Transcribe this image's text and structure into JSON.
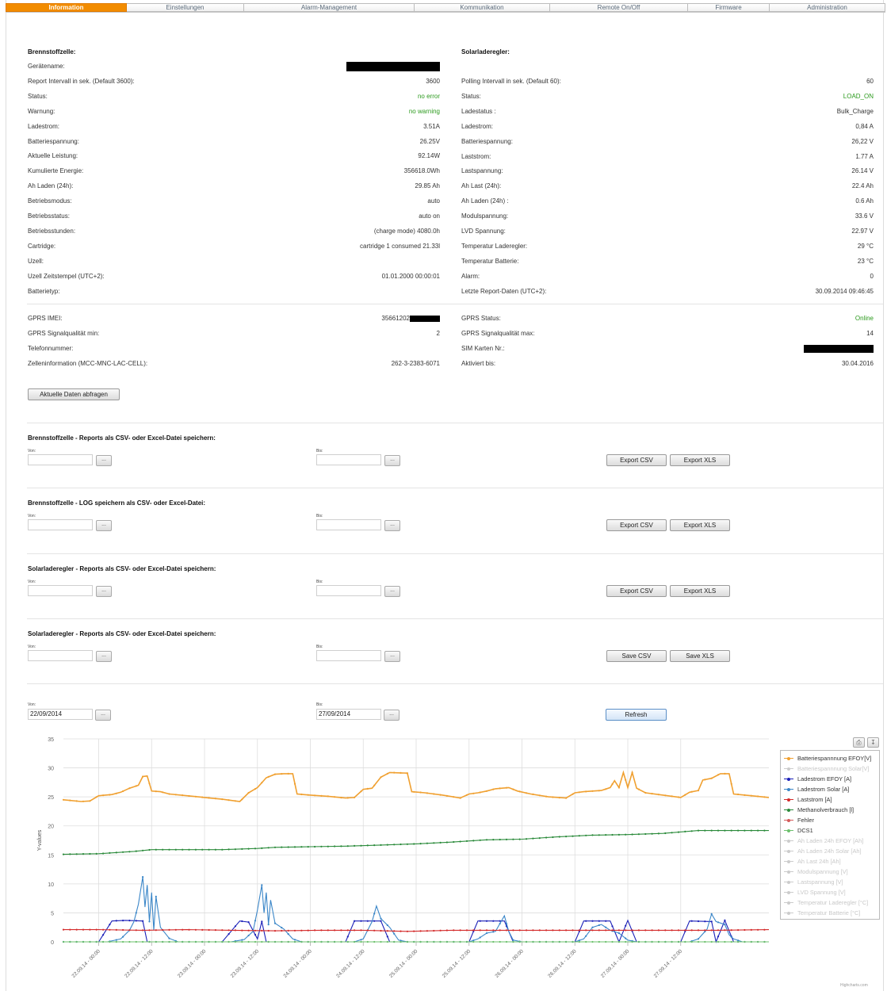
{
  "tabs": [
    "Information",
    "Einstellungen",
    "Alarm-Management",
    "Kommunikation",
    "Remote On/Off",
    "Firmware",
    "Administration"
  ],
  "fuelcell": {
    "title": "Brennstoffzelle:",
    "rows": [
      {
        "label": "Gerätename:",
        "value": ""
      },
      {
        "label": "Report Intervall in sek. (Default 3600):",
        "value": "3600"
      },
      {
        "label": "Status:",
        "value": "no error"
      },
      {
        "label": "Warnung:",
        "value": "no warning"
      },
      {
        "label": "Ladestrom:",
        "value": "3.51A"
      },
      {
        "label": "Batteriespannung:",
        "value": "26.25V"
      },
      {
        "label": "Aktuelle Leistung:",
        "value": "92.14W"
      },
      {
        "label": "Kumulierte Energie:",
        "value": "356618.0Wh"
      },
      {
        "label": "Ah Laden (24h):",
        "value": "29.85 Ah"
      },
      {
        "label": "Betriebsmodus:",
        "value": "auto"
      },
      {
        "label": "Betriebsstatus:",
        "value": "auto on"
      },
      {
        "label": "Betriebsstunden:",
        "value": "(charge mode) 4080.0h"
      },
      {
        "label": "Cartridge:",
        "value": "cartridge 1 consumed 21.33l"
      },
      {
        "label": "Uzell:",
        "value": ""
      },
      {
        "label": "Uzell Zeitstempel (UTC+2):",
        "value": "01.01.2000 00:00:01"
      },
      {
        "label": "Batterietyp:",
        "value": ""
      }
    ]
  },
  "solar": {
    "title": "Solarladeregler:",
    "rows": [
      {
        "label": "Polling Intervall in sek. (Default 60):",
        "value": "60"
      },
      {
        "label": "Status:",
        "value": "LOAD_ON"
      },
      {
        "label": "Ladestatus :",
        "value": "Bulk_Charge"
      },
      {
        "label": "Ladestrom:",
        "value": "0,84 A"
      },
      {
        "label": "Batteriespannung:",
        "value": "26,22 V"
      },
      {
        "label": "Laststrom:",
        "value": "1.77 A"
      },
      {
        "label": "Lastspannung:",
        "value": "26.14 V"
      },
      {
        "label": "Ah Last (24h):",
        "value": "22.4 Ah"
      },
      {
        "label": "Ah Laden (24h) :",
        "value": "0.6 Ah"
      },
      {
        "label": "Modulspannung:",
        "value": "33.6 V"
      },
      {
        "label": "LVD Spannung:",
        "value": "22.97 V"
      },
      {
        "label": "Temperatur Laderegler:",
        "value": "29 °C"
      },
      {
        "label": "Temperatur Batterie:",
        "value": "23 °C"
      },
      {
        "label": "Alarm:",
        "value": "0"
      },
      {
        "label": "Letzte Report-Daten (UTC+2):",
        "value": "30.09.2014 09:46:45"
      }
    ]
  },
  "gprs": {
    "left": [
      {
        "label": "GPRS IMEI:",
        "value": "35661202"
      },
      {
        "label": "GPRS Signalqualität min:",
        "value": "2"
      },
      {
        "label": "Telefonnummer:",
        "value": ""
      },
      {
        "label": "Zelleninformation (MCC-MNC-LAC-CELL):",
        "value": "262-3-2383-6071"
      }
    ],
    "right": [
      {
        "label": "GPRS Status:",
        "value": "Online"
      },
      {
        "label": "GPRS Signalqualität max:",
        "value": "14"
      },
      {
        "label": "SIM Karten Nr.:",
        "value": ""
      },
      {
        "label": "Aktiviert bis:",
        "value": "30.04.2016"
      }
    ]
  },
  "refresh_data_button": "Aktuelle Daten abfragen",
  "exports": [
    {
      "title": "Brennstoffzelle - Reports als CSV- oder Excel-Datei speichern:",
      "from_label": "Von:",
      "to_label": "Bis:",
      "btn1": "Export CSV",
      "btn2": "Export XLS"
    },
    {
      "title": "Brennstoffzelle - LOG speichern als CSV- oder Excel-Datei:",
      "from_label": "Von:",
      "to_label": "Bis:",
      "btn1": "Export CSV",
      "btn2": "Export XLS"
    },
    {
      "title": "Solarladeregler - Reports als CSV- oder Excel-Datei speichern:",
      "from_label": "Von:",
      "to_label": "Bis:",
      "btn1": "Export CSV",
      "btn2": "Export XLS"
    },
    {
      "title": "Solarladeregler - Reports als CSV- oder Excel-Datei speichern:",
      "from_label": "Von:",
      "to_label": "Bis:",
      "btn1": "Save CSV",
      "btn2": "Save XLS"
    }
  ],
  "picker_label": "...",
  "range": {
    "from_label": "Von:",
    "from_value": "22/09/2014",
    "to_label": "Bis:",
    "to_value": "27/09/2014",
    "refresh": "Refresh"
  },
  "chart_tools": {
    "print_icon": "printer-icon",
    "export_icon": "download-icon"
  },
  "credit": "Highcharts.com",
  "colors": {
    "accent_tab": "#f28c00",
    "ok_text": "#2c9a1e"
  },
  "chart_data": {
    "type": "line",
    "ylabel": "Y-values",
    "ylim": [
      0,
      35
    ],
    "yticks": [
      0,
      5,
      10,
      15,
      20,
      25,
      30,
      35
    ],
    "x_tick_labels": [
      "22.09.14 - 00:00",
      "22.09.14 - 12:00",
      "23.09.14 - 00:00",
      "23.09.14 - 12:00",
      "24.09.14 - 00:00",
      "24.09.14 - 12:00",
      "25.09.14 - 00:00",
      "25.09.14 - 12:00",
      "26.09.14 - 00:00",
      "26.09.14 - 12:00",
      "27.09.14 - 00:00",
      "27.09.14 - 12:00"
    ],
    "x_range_hours": [
      -8,
      152
    ],
    "legend_position": "right",
    "series": [
      {
        "name": "Batteriespannnung EFOY[V]",
        "color": "#f0a030",
        "visible": true,
        "points": [
          [
            -8,
            24.5
          ],
          [
            -4,
            24.2
          ],
          [
            -2,
            24.3
          ],
          [
            0,
            25.2
          ],
          [
            3,
            25.4
          ],
          [
            5,
            25.8
          ],
          [
            7,
            26.5
          ],
          [
            9,
            27.0
          ],
          [
            10,
            28.5
          ],
          [
            11,
            28.6
          ],
          [
            12,
            26.0
          ],
          [
            14,
            25.9
          ],
          [
            16,
            25.5
          ],
          [
            20,
            25.2
          ],
          [
            24,
            24.9
          ],
          [
            28,
            24.6
          ],
          [
            32,
            24.2
          ],
          [
            34,
            25.7
          ],
          [
            36,
            26.6
          ],
          [
            38,
            28.3
          ],
          [
            40,
            28.9
          ],
          [
            42,
            29.0
          ],
          [
            44,
            29.0
          ],
          [
            45,
            25.5
          ],
          [
            48,
            25.3
          ],
          [
            52,
            25.1
          ],
          [
            56,
            24.8
          ],
          [
            58,
            24.9
          ],
          [
            60,
            26.3
          ],
          [
            62,
            26.5
          ],
          [
            64,
            28.4
          ],
          [
            66,
            29.2
          ],
          [
            70,
            29.1
          ],
          [
            71,
            25.9
          ],
          [
            74,
            25.7
          ],
          [
            78,
            25.3
          ],
          [
            82,
            24.8
          ],
          [
            84,
            25.5
          ],
          [
            86,
            25.7
          ],
          [
            88,
            26.0
          ],
          [
            90,
            26.4
          ],
          [
            93,
            26.6
          ],
          [
            95,
            26.0
          ],
          [
            98,
            25.5
          ],
          [
            102,
            25.0
          ],
          [
            106,
            24.8
          ],
          [
            108,
            25.7
          ],
          [
            110,
            25.9
          ],
          [
            114,
            26.1
          ],
          [
            116,
            26.6
          ],
          [
            117,
            27.8
          ],
          [
            118,
            26.6
          ],
          [
            119,
            29.2
          ],
          [
            120,
            26.6
          ],
          [
            121,
            29.2
          ],
          [
            122,
            26.5
          ],
          [
            124,
            25.7
          ],
          [
            128,
            25.3
          ],
          [
            132,
            24.9
          ],
          [
            134,
            25.8
          ],
          [
            136,
            26.1
          ],
          [
            137,
            27.9
          ],
          [
            139,
            28.2
          ],
          [
            141,
            29.0
          ],
          [
            143,
            29.0
          ],
          [
            144,
            25.5
          ],
          [
            148,
            25.2
          ],
          [
            152,
            24.9
          ]
        ]
      },
      {
        "name": "Batteriespannnung Solar[V]",
        "color": "#cccccc",
        "visible": false,
        "points": []
      },
      {
        "name": "Ladestrom EFOY [A]",
        "color": "#1a1fb8",
        "visible": true,
        "points": [
          [
            -8,
            0
          ],
          [
            0,
            0
          ],
          [
            3,
            3.6
          ],
          [
            6,
            3.7
          ],
          [
            10,
            3.6
          ],
          [
            11,
            0
          ],
          [
            28,
            0
          ],
          [
            32,
            3.6
          ],
          [
            34,
            3.4
          ],
          [
            36,
            0.5
          ],
          [
            37,
            3.5
          ],
          [
            38,
            0
          ],
          [
            56,
            0
          ],
          [
            58,
            3.6
          ],
          [
            64,
            3.6
          ],
          [
            66,
            0
          ],
          [
            84,
            0
          ],
          [
            86,
            3.6
          ],
          [
            92,
            3.6
          ],
          [
            94,
            0
          ],
          [
            108,
            0
          ],
          [
            110,
            3.6
          ],
          [
            116,
            3.6
          ],
          [
            118,
            0
          ],
          [
            120,
            3.7
          ],
          [
            122,
            0
          ],
          [
            132,
            0
          ],
          [
            134,
            3.6
          ],
          [
            139,
            3.5
          ],
          [
            140,
            0
          ],
          [
            142,
            3.7
          ],
          [
            144,
            0
          ],
          [
            152,
            0
          ]
        ]
      },
      {
        "name": "Ladestrom Solar [A]",
        "color": "#3a86c8",
        "visible": true,
        "points": [
          [
            -8,
            0
          ],
          [
            2,
            0
          ],
          [
            5,
            0.5
          ],
          [
            7,
            2.0
          ],
          [
            8,
            3.5
          ],
          [
            9,
            6.5
          ],
          [
            10,
            11.2
          ],
          [
            10.5,
            6
          ],
          [
            11,
            9.8
          ],
          [
            11.5,
            3.5
          ],
          [
            12,
            8.5
          ],
          [
            12.5,
            2
          ],
          [
            13,
            7.8
          ],
          [
            14,
            2.5
          ],
          [
            16,
            0.6
          ],
          [
            18,
            0
          ],
          [
            30,
            0
          ],
          [
            33,
            0.4
          ],
          [
            35,
            1.8
          ],
          [
            36,
            5.5
          ],
          [
            37,
            9.8
          ],
          [
            37.5,
            5
          ],
          [
            38,
            8.5
          ],
          [
            38.5,
            3
          ],
          [
            39,
            7.2
          ],
          [
            40,
            3.2
          ],
          [
            42,
            2.2
          ],
          [
            44,
            0.5
          ],
          [
            46,
            0
          ],
          [
            58,
            0
          ],
          [
            60,
            0.5
          ],
          [
            62,
            3.5
          ],
          [
            63,
            6.2
          ],
          [
            64,
            4.0
          ],
          [
            66,
            2.5
          ],
          [
            68,
            0.3
          ],
          [
            70,
            0
          ],
          [
            84,
            0
          ],
          [
            86,
            0.5
          ],
          [
            88,
            1.5
          ],
          [
            90,
            1.8
          ],
          [
            92,
            4.5
          ],
          [
            93,
            1.8
          ],
          [
            94,
            0.3
          ],
          [
            96,
            0
          ],
          [
            108,
            0
          ],
          [
            110,
            0.5
          ],
          [
            112,
            2.5
          ],
          [
            114,
            3.0
          ],
          [
            116,
            2.0
          ],
          [
            118,
            1.5
          ],
          [
            120,
            0.3
          ],
          [
            122,
            0
          ],
          [
            134,
            0
          ],
          [
            136,
            0.5
          ],
          [
            138,
            2.2
          ],
          [
            139,
            4.8
          ],
          [
            140,
            3.5
          ],
          [
            142,
            3.0
          ],
          [
            143,
            1.2
          ],
          [
            144,
            0.5
          ],
          [
            146,
            0
          ]
        ]
      },
      {
        "name": "Laststrom [A]",
        "color": "#d42a2a",
        "visible": true,
        "points": [
          [
            -8,
            2.1
          ],
          [
            0,
            2.1
          ],
          [
            10,
            2.0
          ],
          [
            20,
            2.1
          ],
          [
            30,
            2.0
          ],
          [
            40,
            1.9
          ],
          [
            50,
            2.0
          ],
          [
            60,
            2.0
          ],
          [
            70,
            1.8
          ],
          [
            80,
            2.0
          ],
          [
            90,
            2.0
          ],
          [
            100,
            2.0
          ],
          [
            110,
            2.0
          ],
          [
            120,
            2.0
          ],
          [
            130,
            2.0
          ],
          [
            140,
            2.0
          ],
          [
            152,
            2.1
          ]
        ]
      },
      {
        "name": "Methanolverbrauch [l]",
        "color": "#2a8a3a",
        "visible": true,
        "points": [
          [
            -8,
            15.1
          ],
          [
            0,
            15.2
          ],
          [
            8,
            15.6
          ],
          [
            12,
            15.9
          ],
          [
            20,
            15.9
          ],
          [
            28,
            15.9
          ],
          [
            36,
            16.1
          ],
          [
            40,
            16.3
          ],
          [
            48,
            16.4
          ],
          [
            56,
            16.5
          ],
          [
            64,
            16.7
          ],
          [
            72,
            16.9
          ],
          [
            80,
            17.2
          ],
          [
            88,
            17.6
          ],
          [
            96,
            17.7
          ],
          [
            104,
            18.1
          ],
          [
            112,
            18.4
          ],
          [
            120,
            18.5
          ],
          [
            128,
            18.7
          ],
          [
            136,
            19.2
          ],
          [
            144,
            19.2
          ],
          [
            152,
            19.2
          ]
        ]
      },
      {
        "name": "Fehler",
        "color": "#d45a5a",
        "visible": true,
        "points": []
      },
      {
        "name": "DCS1",
        "color": "#6cc06c",
        "visible": true,
        "points": [
          [
            -8,
            0
          ],
          [
            152,
            0
          ]
        ]
      },
      {
        "name": "Ah Laden 24h EFOY [Ah]",
        "color": "#cccccc",
        "visible": false,
        "points": []
      },
      {
        "name": "Ah Laden 24h Solar [Ah]",
        "color": "#cccccc",
        "visible": false,
        "points": []
      },
      {
        "name": "Ah Last 24h [Ah]",
        "color": "#cccccc",
        "visible": false,
        "points": []
      },
      {
        "name": "Modulspannung [V]",
        "color": "#cccccc",
        "visible": false,
        "points": []
      },
      {
        "name": "Lastspannung [V]",
        "color": "#cccccc",
        "visible": false,
        "points": []
      },
      {
        "name": "LVD Spannung [V]",
        "color": "#cccccc",
        "visible": false,
        "points": []
      },
      {
        "name": "Temperatur Laderegler [°C]",
        "color": "#cccccc",
        "visible": false,
        "points": []
      },
      {
        "name": "Temperatur Batterie [°C]",
        "color": "#cccccc",
        "visible": false,
        "points": []
      }
    ]
  }
}
